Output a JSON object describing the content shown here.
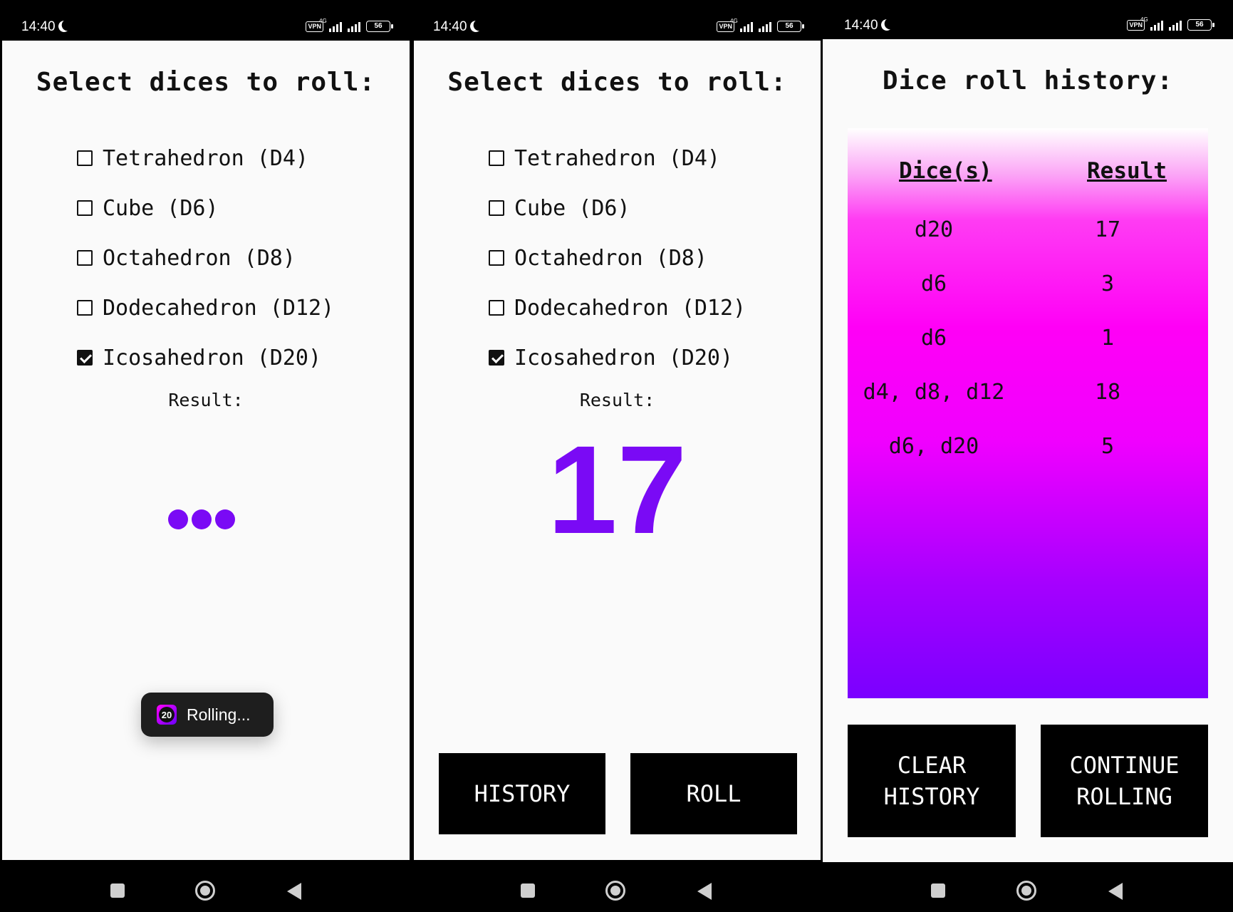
{
  "status_bar": {
    "time": "14:40",
    "vpn": "VPN",
    "network": "4G",
    "battery": "56"
  },
  "roll_screen": {
    "title": "Select dices to roll:",
    "dice": [
      {
        "label": "Tetrahedron (D4)",
        "checked": false
      },
      {
        "label": "Cube (D6)",
        "checked": false
      },
      {
        "label": "Octahedron (D8)",
        "checked": false
      },
      {
        "label": "Dodecahedron (D12)",
        "checked": false
      },
      {
        "label": "Icosahedron (D20)",
        "checked": true
      }
    ],
    "result_label": "Result:",
    "result_value": "17",
    "toast": {
      "icon_text": "20",
      "text": "Rolling..."
    },
    "history_button": "HISTORY",
    "roll_button": "ROLL"
  },
  "history_screen": {
    "title": "Dice roll history:",
    "columns": [
      "Dice(s)",
      "Result"
    ],
    "rows": [
      {
        "dice": "d20",
        "result": "17"
      },
      {
        "dice": "d6",
        "result": "3"
      },
      {
        "dice": "d6",
        "result": "1"
      },
      {
        "dice": "d4, d8, d12",
        "result": "18"
      },
      {
        "dice": "d6, d20",
        "result": "5"
      }
    ],
    "clear_button": "CLEAR HISTORY",
    "continue_button": "CONTINUE ROLLING"
  },
  "colors": {
    "accent": "#7a0af5",
    "button": "#000000"
  }
}
